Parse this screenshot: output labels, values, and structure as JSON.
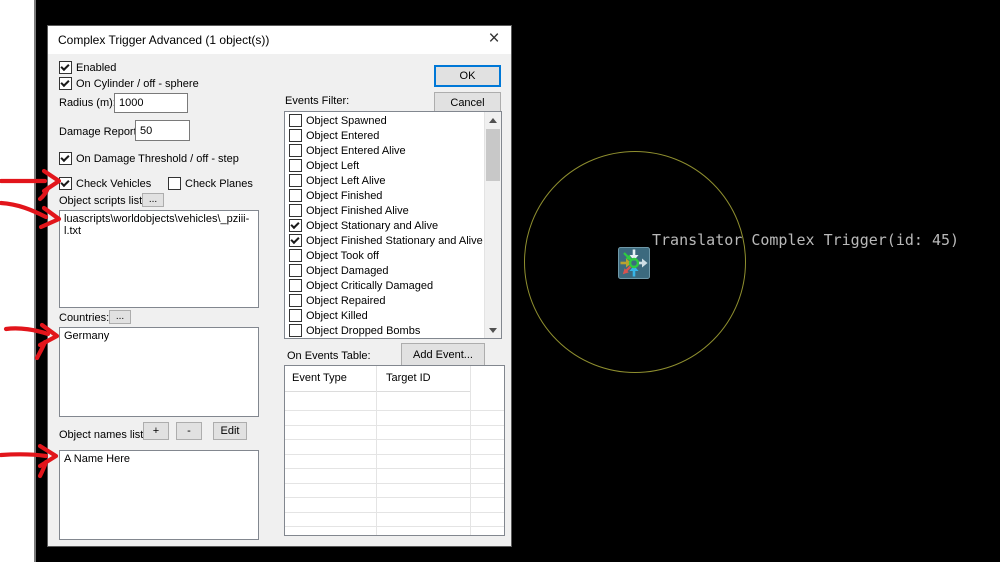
{
  "window": {
    "title": "Complex Trigger Advanced (1 object(s))",
    "close_glyph": "×"
  },
  "actions": {
    "ok": "OK",
    "cancel": "Cancel"
  },
  "controls": {
    "enabled": {
      "label": "Enabled",
      "checked": true
    },
    "cylinder": {
      "label": "On Cylinder / off - sphere",
      "checked": true
    },
    "radius": {
      "label": "Radius (m):",
      "value": "1000"
    },
    "damage_report": {
      "label": "Damage Report:",
      "value": "50"
    },
    "damage_threshold": {
      "label": "On Damage Threshold / off - step",
      "checked": true
    },
    "check_vehicles": {
      "label": "Check Vehicles",
      "checked": true
    },
    "check_planes": {
      "label": "Check Planes",
      "checked": false
    }
  },
  "object_scripts": {
    "label": "Object scripts list",
    "browse": "...",
    "items": [
      "luascripts\\worldobjects\\vehicles\\_pziii-l.txt"
    ]
  },
  "countries": {
    "label": "Countries:",
    "browse": "...",
    "items": [
      "Germany"
    ]
  },
  "object_names": {
    "label": "Object names list:",
    "add": "+",
    "remove": "-",
    "edit": "Edit",
    "items": [
      "A Name Here"
    ]
  },
  "events_filter": {
    "label": "Events Filter:",
    "items": [
      {
        "label": "Object Spawned",
        "checked": false
      },
      {
        "label": "Object Entered",
        "checked": false
      },
      {
        "label": "Object Entered Alive",
        "checked": false
      },
      {
        "label": "Object Left",
        "checked": false
      },
      {
        "label": "Object Left Alive",
        "checked": false
      },
      {
        "label": "Object Finished",
        "checked": false
      },
      {
        "label": "Object Finished Alive",
        "checked": false
      },
      {
        "label": "Object Stationary and Alive",
        "checked": true
      },
      {
        "label": "Object Finished Stationary and Alive",
        "checked": true
      },
      {
        "label": "Object Took off",
        "checked": false
      },
      {
        "label": "Object Damaged",
        "checked": false
      },
      {
        "label": "Object Critically Damaged",
        "checked": false
      },
      {
        "label": "Object Repaired",
        "checked": false
      },
      {
        "label": "Object Killed",
        "checked": false
      },
      {
        "label": "Object Dropped Bombs",
        "checked": false
      }
    ]
  },
  "events_table": {
    "label": "On Events Table:",
    "add_event": "Add Event...",
    "columns": [
      "Event Type",
      "Target ID"
    ],
    "rows": [],
    "empty_row_count": 9
  },
  "game": {
    "trigger_label": "Translator Complex Trigger(id: 45)",
    "circle_color": "#8f8f2f"
  },
  "annotations": {
    "color": "#e2151b",
    "arrow_targets": [
      "check-vehicles",
      "object-scripts-item",
      "countries-item",
      "object-names-item"
    ]
  }
}
